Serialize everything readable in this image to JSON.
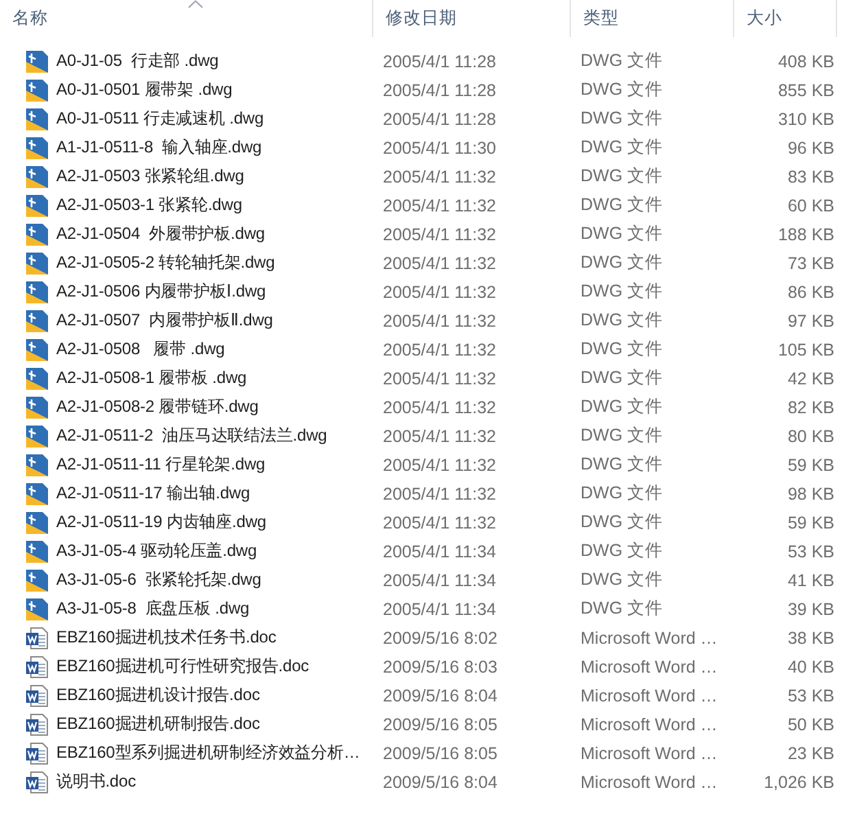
{
  "table": {
    "columns": [
      {
        "label": "名称",
        "sorted": true
      },
      {
        "label": "修改日期",
        "sorted": false
      },
      {
        "label": "类型",
        "sorted": false
      },
      {
        "label": "大小",
        "sorted": false
      }
    ],
    "rows": [
      {
        "kind": "dwg",
        "name": "A0-J1-05  行走部 .dwg",
        "modified": "2005/4/1 11:28",
        "type": "DWG 文件",
        "size": "408 KB"
      },
      {
        "kind": "dwg",
        "name": "A0-J1-0501 履带架 .dwg",
        "modified": "2005/4/1 11:28",
        "type": "DWG 文件",
        "size": "855 KB"
      },
      {
        "kind": "dwg",
        "name": "A0-J1-0511 行走减速机 .dwg",
        "modified": "2005/4/1 11:28",
        "type": "DWG 文件",
        "size": "310 KB"
      },
      {
        "kind": "dwg",
        "name": "A1-J1-0511-8  输入轴座.dwg",
        "modified": "2005/4/1 11:30",
        "type": "DWG 文件",
        "size": "96 KB"
      },
      {
        "kind": "dwg",
        "name": "A2-J1-0503 张紧轮组.dwg",
        "modified": "2005/4/1 11:32",
        "type": "DWG 文件",
        "size": "83 KB"
      },
      {
        "kind": "dwg",
        "name": "A2-J1-0503-1 张紧轮.dwg",
        "modified": "2005/4/1 11:32",
        "type": "DWG 文件",
        "size": "60 KB"
      },
      {
        "kind": "dwg",
        "name": "A2-J1-0504  外履带护板.dwg",
        "modified": "2005/4/1 11:32",
        "type": "DWG 文件",
        "size": "188 KB"
      },
      {
        "kind": "dwg",
        "name": "A2-J1-0505-2 转轮轴托架.dwg",
        "modified": "2005/4/1 11:32",
        "type": "DWG 文件",
        "size": "73 KB"
      },
      {
        "kind": "dwg",
        "name": "A2-J1-0506 内履带护板Ⅰ.dwg",
        "modified": "2005/4/1 11:32",
        "type": "DWG 文件",
        "size": "86 KB"
      },
      {
        "kind": "dwg",
        "name": "A2-J1-0507  内履带护板Ⅱ.dwg",
        "modified": "2005/4/1 11:32",
        "type": "DWG 文件",
        "size": "97 KB"
      },
      {
        "kind": "dwg",
        "name": "A2-J1-0508   履带 .dwg",
        "modified": "2005/4/1 11:32",
        "type": "DWG 文件",
        "size": "105 KB"
      },
      {
        "kind": "dwg",
        "name": "A2-J1-0508-1 履带板 .dwg",
        "modified": "2005/4/1 11:32",
        "type": "DWG 文件",
        "size": "42 KB"
      },
      {
        "kind": "dwg",
        "name": "A2-J1-0508-2 履带链环.dwg",
        "modified": "2005/4/1 11:32",
        "type": "DWG 文件",
        "size": "82 KB"
      },
      {
        "kind": "dwg",
        "name": "A2-J1-0511-2  油压马达联结法兰.dwg",
        "modified": "2005/4/1 11:32",
        "type": "DWG 文件",
        "size": "80 KB"
      },
      {
        "kind": "dwg",
        "name": "A2-J1-0511-11 行星轮架.dwg",
        "modified": "2005/4/1 11:32",
        "type": "DWG 文件",
        "size": "59 KB"
      },
      {
        "kind": "dwg",
        "name": "A2-J1-0511-17 输出轴.dwg",
        "modified": "2005/4/1 11:32",
        "type": "DWG 文件",
        "size": "98 KB"
      },
      {
        "kind": "dwg",
        "name": "A2-J1-0511-19 内齿轴座.dwg",
        "modified": "2005/4/1 11:32",
        "type": "DWG 文件",
        "size": "59 KB"
      },
      {
        "kind": "dwg",
        "name": "A3-J1-05-4 驱动轮压盖.dwg",
        "modified": "2005/4/1 11:34",
        "type": "DWG 文件",
        "size": "53 KB"
      },
      {
        "kind": "dwg",
        "name": "A3-J1-05-6  张紧轮托架.dwg",
        "modified": "2005/4/1 11:34",
        "type": "DWG 文件",
        "size": "41 KB"
      },
      {
        "kind": "dwg",
        "name": "A3-J1-05-8  底盘压板 .dwg",
        "modified": "2005/4/1 11:34",
        "type": "DWG 文件",
        "size": "39 KB"
      },
      {
        "kind": "doc",
        "name": "EBZ160掘进机技术任务书.doc",
        "modified": "2009/5/16 8:02",
        "type": "Microsoft Word …",
        "size": "38 KB"
      },
      {
        "kind": "doc",
        "name": "EBZ160掘进机可行性研究报告.doc",
        "modified": "2009/5/16 8:03",
        "type": "Microsoft Word …",
        "size": "40 KB"
      },
      {
        "kind": "doc",
        "name": "EBZ160掘进机设计报告.doc",
        "modified": "2009/5/16 8:04",
        "type": "Microsoft Word …",
        "size": "53 KB"
      },
      {
        "kind": "doc",
        "name": "EBZ160掘进机研制报告.doc",
        "modified": "2009/5/16 8:05",
        "type": "Microsoft Word …",
        "size": "50 KB"
      },
      {
        "kind": "doc",
        "name": "EBZ160型系列掘进机研制经济效益分析…",
        "modified": "2009/5/16 8:05",
        "type": "Microsoft Word …",
        "size": "23 KB"
      },
      {
        "kind": "doc",
        "name": "说明书.doc",
        "modified": "2009/5/16 8:04",
        "type": "Microsoft Word …",
        "size": "1,026 KB"
      }
    ]
  }
}
